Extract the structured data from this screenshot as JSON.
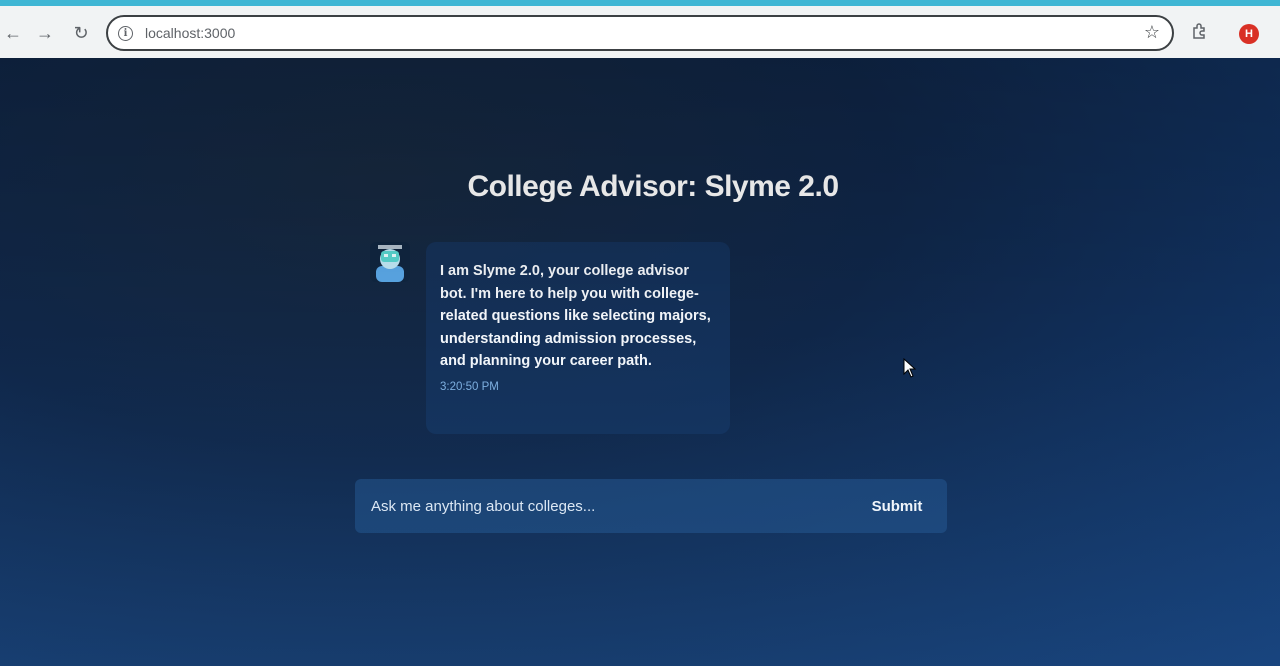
{
  "browser": {
    "url": "localhost:3000",
    "profile_initial": "H"
  },
  "page": {
    "title": "College Advisor: Slyme 2.0"
  },
  "messages": [
    {
      "sender": "bot",
      "text": "I am Slyme 2.0, your college advisor bot. I'm here to help you with college-related questions like selecting majors, understanding admission processes, and planning your career path.",
      "time": "3:20:50 PM"
    }
  ],
  "composer": {
    "placeholder": "Ask me anything about colleges...",
    "submit_label": "Submit"
  },
  "colors": {
    "accent": "#3fb6d4",
    "background": "#0f2648",
    "timestamp": "#7fb0e0"
  }
}
